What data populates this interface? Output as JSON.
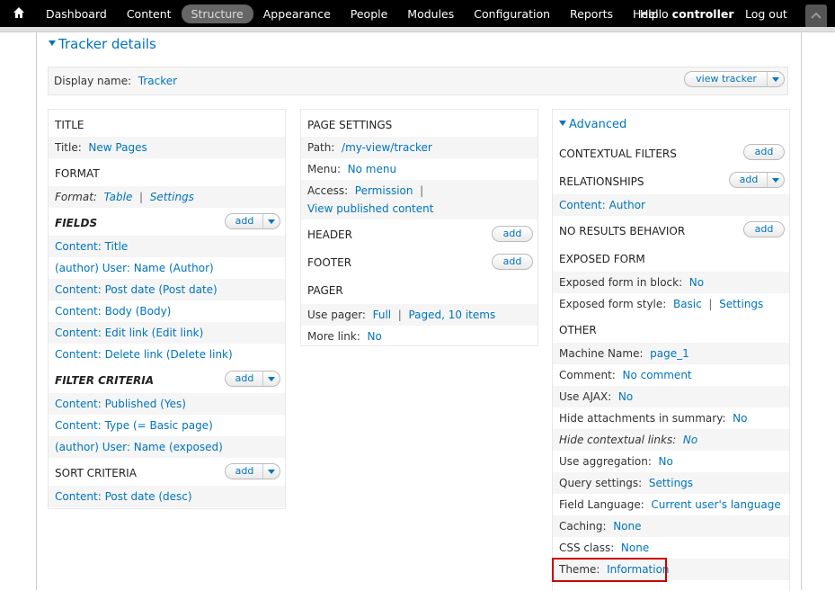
{
  "toolbar": {
    "items": [
      "Dashboard",
      "Content",
      "Structure",
      "Appearance",
      "People",
      "Modules",
      "Configuration",
      "Reports",
      "Help"
    ],
    "active": "Structure",
    "hello_prefix": "Hello",
    "user": "controller",
    "logout": "Log out"
  },
  "view": {
    "title": "Tracker details",
    "display_name_label": "Display name:",
    "display_name_value": "Tracker",
    "view_button": "view tracker"
  },
  "col1": {
    "title_hdr": "TITLE",
    "title_label": "Title:",
    "title_value": "New Pages",
    "format_hdr": "FORMAT",
    "format_label": "Format:",
    "format_value": "Table",
    "format_settings": "Settings",
    "fields_hdr": "FIELDS",
    "fields": [
      "Content: Title",
      "(author) User: Name (Author)",
      "Content: Post date (Post date)",
      "Content: Body (Body)",
      "Content: Edit link (Edit link)",
      "Content: Delete link (Delete link)"
    ],
    "filter_hdr": "FILTER CRITERIA",
    "filters": [
      "Content: Published (Yes)",
      "Content: Type (= Basic page)",
      "(author) User: Name (exposed)"
    ],
    "sort_hdr": "SORT CRITERIA",
    "sorts": [
      "Content: Post date (desc)"
    ],
    "add": "add"
  },
  "col2": {
    "page_settings_hdr": "PAGE SETTINGS",
    "path_label": "Path:",
    "path_value": "/my-view/tracker",
    "menu_label": "Menu:",
    "menu_value": "No menu",
    "access_label": "Access:",
    "access_value": "Permission",
    "access_value2": "View published content",
    "header_hdr": "HEADER",
    "footer_hdr": "FOOTER",
    "pager_hdr": "PAGER",
    "use_pager_label": "Use pager:",
    "use_pager_value": "Full",
    "use_pager_value2": "Paged, 10 items",
    "more_link_label": "More link:",
    "more_link_value": "No",
    "add": "add"
  },
  "col3": {
    "advanced": "Advanced",
    "contextual_hdr": "CONTEXTUAL FILTERS",
    "relationships_hdr": "RELATIONSHIPS",
    "relationship_item": "Content: Author",
    "no_results_hdr": "NO RESULTS BEHAVIOR",
    "exposed_hdr": "EXPOSED FORM",
    "exposed_block_label": "Exposed form in block:",
    "exposed_block_value": "No",
    "exposed_style_label": "Exposed form style:",
    "exposed_style_value": "Basic",
    "exposed_style_settings": "Settings",
    "other_hdr": "OTHER",
    "other": [
      {
        "label": "Machine Name:",
        "value": "page_1"
      },
      {
        "label": "Comment:",
        "value": "No comment"
      },
      {
        "label": "Use AJAX:",
        "value": "No"
      },
      {
        "label": "Hide attachments in summary:",
        "value": "No"
      },
      {
        "label": "Hide contextual links:",
        "value": "No"
      },
      {
        "label": "Use aggregation:",
        "value": "No"
      },
      {
        "label": "Query settings:",
        "value": "Settings"
      },
      {
        "label": "Field Language:",
        "value": "Current user's language"
      },
      {
        "label": "Caching:",
        "value": "None"
      },
      {
        "label": "CSS class:",
        "value": "None"
      },
      {
        "label": "Theme:",
        "value": "Information"
      }
    ],
    "add": "add"
  },
  "colors": {
    "link": "#0074bd",
    "toolbar": "#000000",
    "highlight": "#cc0000"
  }
}
